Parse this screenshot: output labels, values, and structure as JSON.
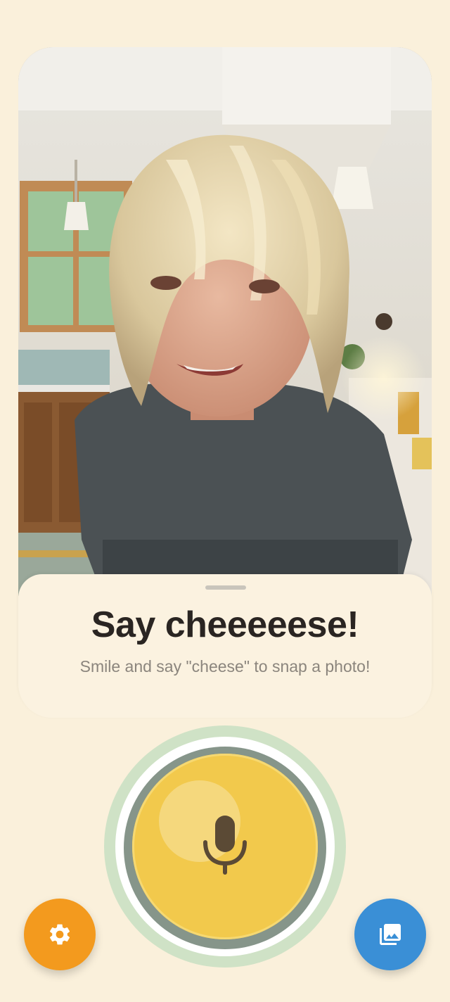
{
  "prompt": {
    "title": "Say cheeeeese!",
    "subtitle": "Smile and say \"cheese\" to snap a photo!"
  },
  "camera": {
    "preview_subject": "camera-preview"
  },
  "icons": {
    "mic": "microphone-icon",
    "settings": "gear-icon",
    "gallery": "gallery-icon"
  },
  "colors": {
    "background": "#FAF0DB",
    "card": "#FBF2E0",
    "mic_button": "#F2C94C",
    "mic_ring": "#CFE2C6",
    "settings_button": "#F39A1E",
    "gallery_button": "#3A8FD6",
    "title_text": "#2A2522",
    "subtitle_text": "#8B857D"
  }
}
